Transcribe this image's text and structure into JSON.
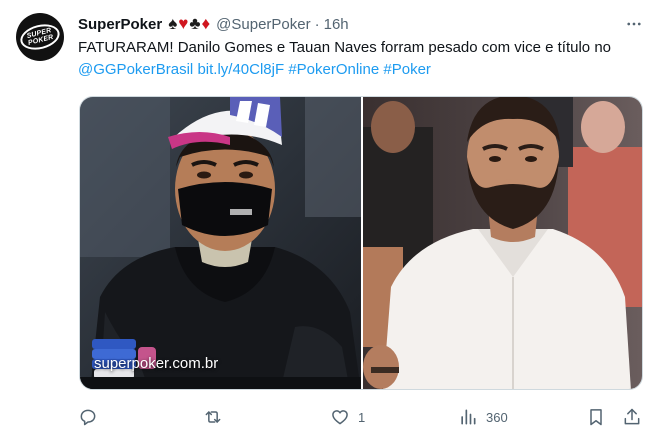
{
  "tweet": {
    "author": {
      "display_name": "SuperPoker",
      "handle": "@SuperPoker",
      "avatar_text": [
        "SUPER",
        "POKER"
      ],
      "name_suits": [
        "♠",
        "♥",
        "♣",
        "♦"
      ]
    },
    "separator": "·",
    "time": "16h",
    "more_icon": "more-horizontal-icon",
    "text": {
      "prefix": "FATURARAM! Danilo Gomes e Tauan Naves forram pesado com vice e título no ",
      "mention": "@GGPokerBrasil",
      "link": "bit.ly/40Cl8jF",
      "hashtag1": "#PokerOnline",
      "hashtag2": "#Poker"
    },
    "media": {
      "watermark": "superpoker.com.br"
    },
    "actions": {
      "reply_count": "",
      "retweet_count": "",
      "like_count": "1",
      "views_count": "360"
    }
  },
  "colors": {
    "link": "#1d9bf0",
    "text": "#0f1419",
    "secondary": "#536471",
    "suit_red": "#d0161f"
  },
  "icons": [
    "reply-icon",
    "retweet-icon",
    "like-icon",
    "views-icon",
    "bookmark-icon",
    "share-icon"
  ]
}
